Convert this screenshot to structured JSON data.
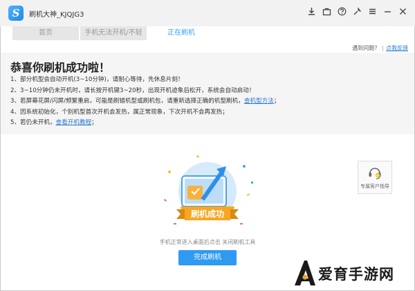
{
  "app": {
    "title": "刷机大神_KJQJG3",
    "logo_letter": "S"
  },
  "titlebar": {
    "icons": [
      "download-icon",
      "briefcase-icon",
      "help-icon",
      "wrench-icon",
      "menu-icon",
      "minimize-icon",
      "close-icon"
    ]
  },
  "tabs": [
    {
      "label": "首页",
      "active": false
    },
    {
      "label": "手机无法开机/不轻",
      "active": false
    },
    {
      "label": "正在刷机",
      "active": true
    }
  ],
  "help": {
    "prefix": "遇到问题？",
    "link": "点我反馈"
  },
  "notice": {
    "heading": "恭喜你刷机成功啦！",
    "tips": [
      {
        "text": "1、部分机型会自动开机(3~10分钟)，请耐心等待，先休息片刻！",
        "link": ""
      },
      {
        "text": "2、3~10分钟仍未开机时，请长按开机键3~20秒，出现开机迹象后松开，系统会自动启动！",
        "link": ""
      },
      {
        "text": "3、若屏幕花屏/闪屏/频繁重启，可能是刷错机型或刷机包，请重新选择正确的机型刷机，",
        "link": "查机型方法",
        "suffix": "；"
      },
      {
        "text": "4、因系统初始化，个别机型首次开机会发热，属正常现象，下次开机不会再发热；",
        "link": ""
      },
      {
        "text": "5、若仍未开机，",
        "link": "查看开机教程",
        "suffix": "；"
      }
    ]
  },
  "service": {
    "label": "专属客户指导"
  },
  "illustration": {
    "ribbon": "刷机成功"
  },
  "status": {
    "text": "手机正常进入桌面后点击 关闭刷机工具"
  },
  "done_button": {
    "label": "完成刷机"
  },
  "watermark": {
    "text": "爱育手游网"
  },
  "colors": {
    "accent": "#2f9af2",
    "link": "#2a7ad5",
    "ribbon": "#f7a623"
  }
}
